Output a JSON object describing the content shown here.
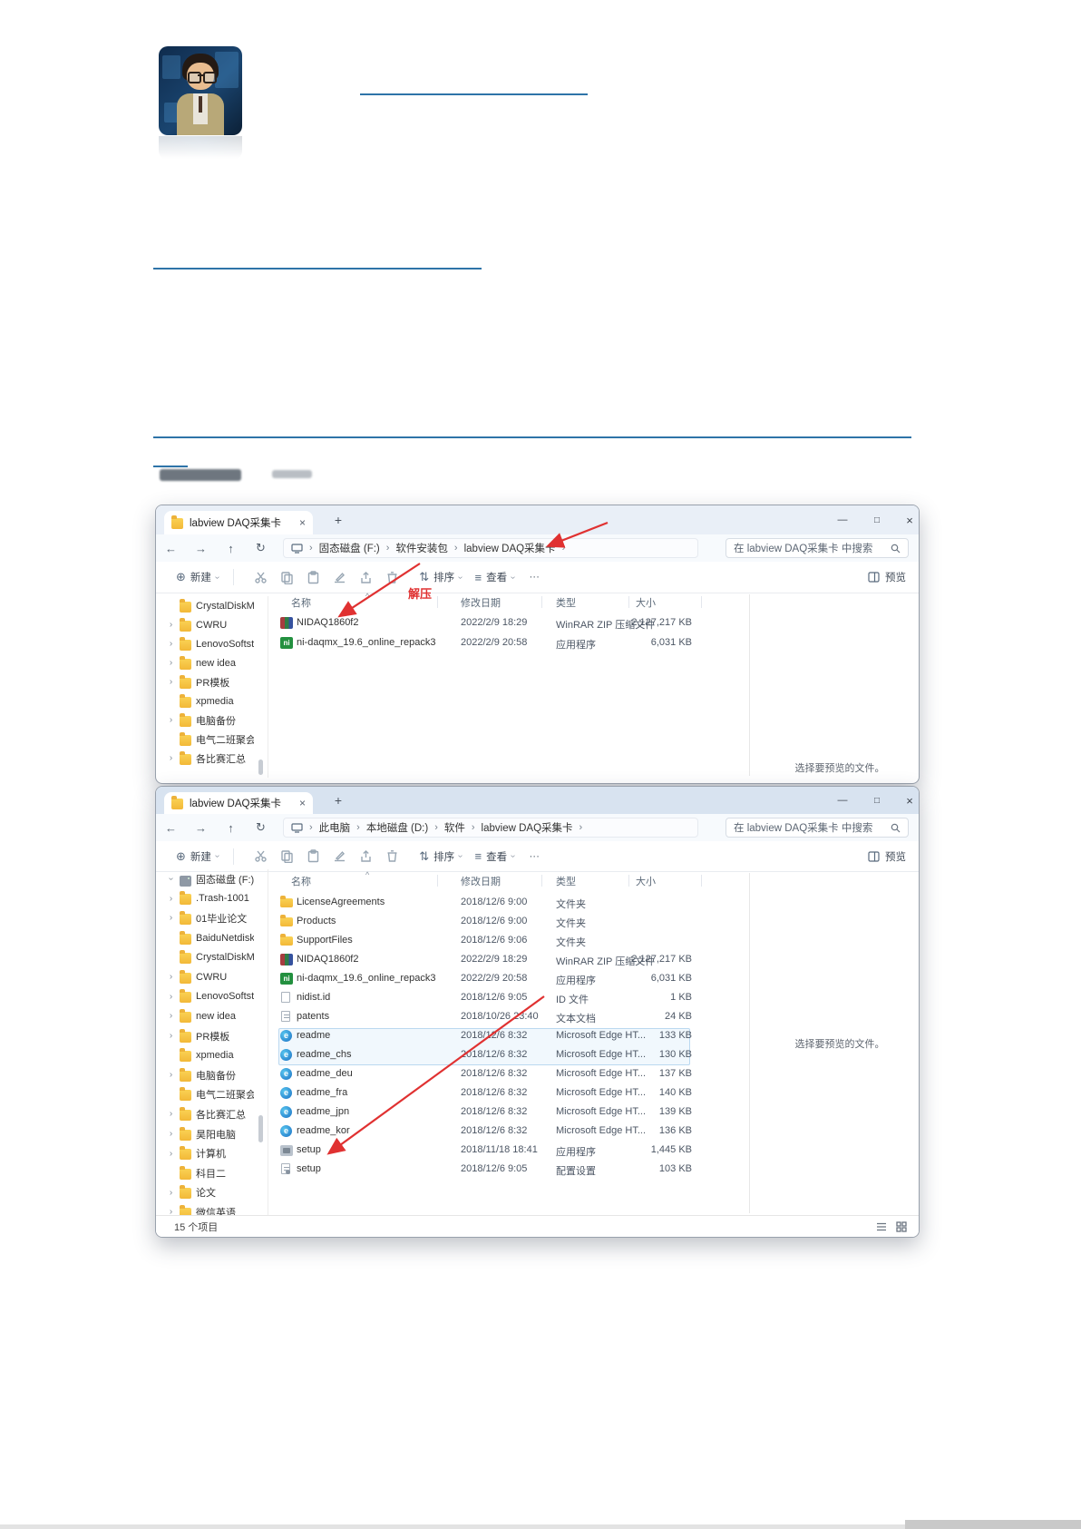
{
  "accent": {
    "link_blue": "#2e74a8",
    "annotation_red": "#e03131"
  },
  "glyphs": {
    "new": "⊕",
    "sort": "⇅",
    "view": "≡",
    "more": "···",
    "back": "←",
    "forward": "→",
    "up": "↑",
    "refresh": "↻",
    "minimize": "—",
    "maximize": "□",
    "close": "×",
    "tab_close": "×",
    "new_tab": "+",
    "sort_caret": "^"
  },
  "toolbar": {
    "new": "新建",
    "sort": "排序",
    "view": "查看",
    "preview": "预览"
  },
  "columns": {
    "name": "名称",
    "date": "修改日期",
    "type": "类型",
    "size": "大小"
  },
  "search_placeholder": "在 labview DAQ采集卡 中搜索",
  "preview_hint": "选择要预览的文件。",
  "annotations": {
    "extract_label": "解压"
  },
  "window1": {
    "tab_title": "labview DAQ采集卡",
    "breadcrumbs": [
      "固态磁盘 (F:)",
      "软件安装包",
      "labview DAQ采集卡"
    ],
    "sidebar": [
      {
        "label": "CrystalDiskMark",
        "chev": "",
        "icon": "folder"
      },
      {
        "label": "CWRU",
        "chev": "r",
        "icon": "folder"
      },
      {
        "label": "LenovoSoftstore",
        "chev": "r",
        "icon": "folder"
      },
      {
        "label": "new idea",
        "chev": "r",
        "icon": "folder"
      },
      {
        "label": "PR模板",
        "chev": "r",
        "icon": "folder"
      },
      {
        "label": "xpmedia",
        "chev": "",
        "icon": "folder"
      },
      {
        "label": "电脑备份",
        "chev": "r",
        "icon": "folder"
      },
      {
        "label": "电气二班聚会",
        "chev": "",
        "icon": "folder"
      },
      {
        "label": "各比赛汇总",
        "chev": "r",
        "icon": "folder"
      }
    ],
    "files": [
      {
        "name": "NIDAQ1860f2",
        "date": "2022/2/9 18:29",
        "type": "WinRAR ZIP 压缩文件",
        "size": "2,127,217 KB",
        "icon": "winrar"
      },
      {
        "name": "ni-daqmx_19.6_online_repack3",
        "date": "2022/2/9 20:58",
        "type": "应用程序",
        "size": "6,031 KB",
        "icon": "ni"
      }
    ]
  },
  "window2": {
    "tab_title": "labview DAQ采集卡",
    "breadcrumbs": [
      "此电脑",
      "本地磁盘 (D:)",
      "软件",
      "labview DAQ采集卡"
    ],
    "status": "15 个项目",
    "sidebar": [
      {
        "label": "固态磁盘 (F:)",
        "chev": "d",
        "icon": "drive"
      },
      {
        "label": ".Trash-1001",
        "chev": "r",
        "icon": "folder"
      },
      {
        "label": "01毕业论文",
        "chev": "r",
        "icon": "folder"
      },
      {
        "label": "BaiduNetdiskDo",
        "chev": "",
        "icon": "folder"
      },
      {
        "label": "CrystalDiskMark",
        "chev": "",
        "icon": "folder"
      },
      {
        "label": "CWRU",
        "chev": "r",
        "icon": "folder"
      },
      {
        "label": "LenovoSoftstore",
        "chev": "r",
        "icon": "folder"
      },
      {
        "label": "new idea",
        "chev": "r",
        "icon": "folder"
      },
      {
        "label": "PR模板",
        "chev": "r",
        "icon": "folder"
      },
      {
        "label": "xpmedia",
        "chev": "",
        "icon": "folder"
      },
      {
        "label": "电脑备份",
        "chev": "r",
        "icon": "folder"
      },
      {
        "label": "电气二班聚会",
        "chev": "",
        "icon": "folder"
      },
      {
        "label": "各比赛汇总",
        "chev": "r",
        "icon": "folder"
      },
      {
        "label": "昊阳电脑",
        "chev": "r",
        "icon": "folder"
      },
      {
        "label": "计算机",
        "chev": "r",
        "icon": "folder"
      },
      {
        "label": "科目二",
        "chev": "",
        "icon": "folder"
      },
      {
        "label": "论文",
        "chev": "r",
        "icon": "folder"
      },
      {
        "label": "微信英语",
        "chev": "r",
        "icon": "folder"
      }
    ],
    "files": [
      {
        "name": "LicenseAgreements",
        "date": "2018/12/6 9:00",
        "type": "文件夹",
        "size": "",
        "icon": "folder"
      },
      {
        "name": "Products",
        "date": "2018/12/6 9:00",
        "type": "文件夹",
        "size": "",
        "icon": "folder"
      },
      {
        "name": "SupportFiles",
        "date": "2018/12/6 9:06",
        "type": "文件夹",
        "size": "",
        "icon": "folder"
      },
      {
        "name": "NIDAQ1860f2",
        "date": "2022/2/9 18:29",
        "type": "WinRAR ZIP 压缩文件",
        "size": "2,127,217 KB",
        "icon": "winrar"
      },
      {
        "name": "ni-daqmx_19.6_online_repack3",
        "date": "2022/2/9 20:58",
        "type": "应用程序",
        "size": "6,031 KB",
        "icon": "ni"
      },
      {
        "name": "nidist.id",
        "date": "2018/12/6 9:05",
        "type": "ID 文件",
        "size": "1 KB",
        "icon": "idfile"
      },
      {
        "name": "patents",
        "date": "2018/10/26 23:40",
        "type": "文本文档",
        "size": "24 KB",
        "icon": "textdoc"
      },
      {
        "name": "readme",
        "date": "2018/12/6 8:32",
        "type": "Microsoft Edge HT...",
        "size": "133 KB",
        "icon": "edge"
      },
      {
        "name": "readme_chs",
        "date": "2018/12/6 8:32",
        "type": "Microsoft Edge HT...",
        "size": "130 KB",
        "icon": "edge"
      },
      {
        "name": "readme_deu",
        "date": "2018/12/6 8:32",
        "type": "Microsoft Edge HT...",
        "size": "137 KB",
        "icon": "edge"
      },
      {
        "name": "readme_fra",
        "date": "2018/12/6 8:32",
        "type": "Microsoft Edge HT...",
        "size": "140 KB",
        "icon": "edge"
      },
      {
        "name": "readme_jpn",
        "date": "2018/12/6 8:32",
        "type": "Microsoft Edge HT...",
        "size": "139 KB",
        "icon": "edge"
      },
      {
        "name": "readme_kor",
        "date": "2018/12/6 8:32",
        "type": "Microsoft Edge HT...",
        "size": "136 KB",
        "icon": "edge"
      },
      {
        "name": "setup",
        "date": "2018/11/18 18:41",
        "type": "应用程序",
        "size": "1,445 KB",
        "icon": "setupapp"
      },
      {
        "name": "setup",
        "date": "2018/12/6 9:05",
        "type": "配置设置",
        "size": "103 KB",
        "icon": "config"
      }
    ]
  }
}
